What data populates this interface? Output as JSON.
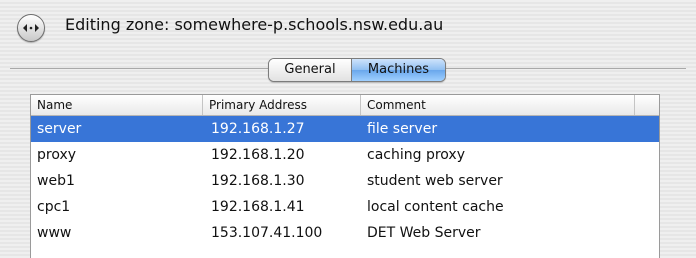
{
  "window": {
    "title": "Editing zone: somewhere-p.schools.nsw.edu.au",
    "back_icon": "back-forward-icon"
  },
  "tabs": [
    {
      "label": "General",
      "active": false
    },
    {
      "label": "Machines",
      "active": true
    }
  ],
  "table": {
    "columns": [
      "Name",
      "Primary Address",
      "Comment"
    ],
    "rows": [
      {
        "name": "server",
        "address": "192.168.1.27",
        "comment": "file server",
        "selected": true
      },
      {
        "name": "proxy",
        "address": "192.168.1.20",
        "comment": "caching proxy",
        "selected": false
      },
      {
        "name": "web1",
        "address": "192.168.1.30",
        "comment": "student web server",
        "selected": false
      },
      {
        "name": "cpc1",
        "address": "192.168.1.41",
        "comment": "local content cache",
        "selected": false
      },
      {
        "name": "www",
        "address": "153.107.41.100",
        "comment": "DET Web Server",
        "selected": false
      }
    ]
  },
  "colors": {
    "selection": "#3875d7",
    "active_tab": "#6aa7ec"
  }
}
